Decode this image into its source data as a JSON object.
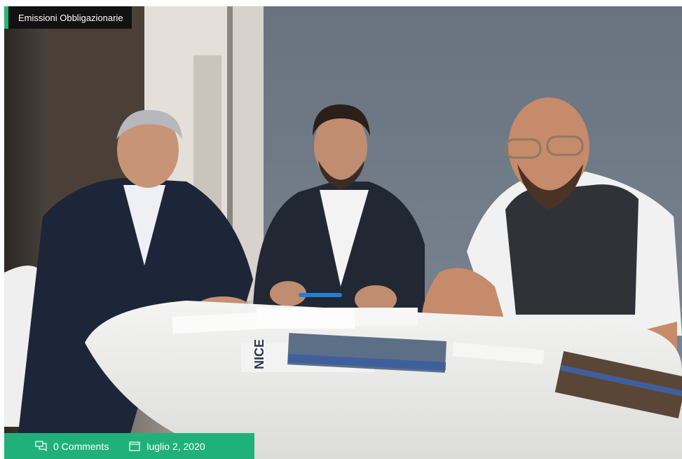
{
  "post": {
    "category": "Emissioni Obbligazionarie",
    "comments_label": "0 Comments",
    "date_label": "luglio 2, 2020",
    "image_alt": "Three men sitting at a white meeting table with documents"
  },
  "icons": {
    "comments": "comments-icon",
    "date": "calendar-icon"
  },
  "colors": {
    "accent_green": "#20b17a",
    "tag_background": "#111111"
  }
}
